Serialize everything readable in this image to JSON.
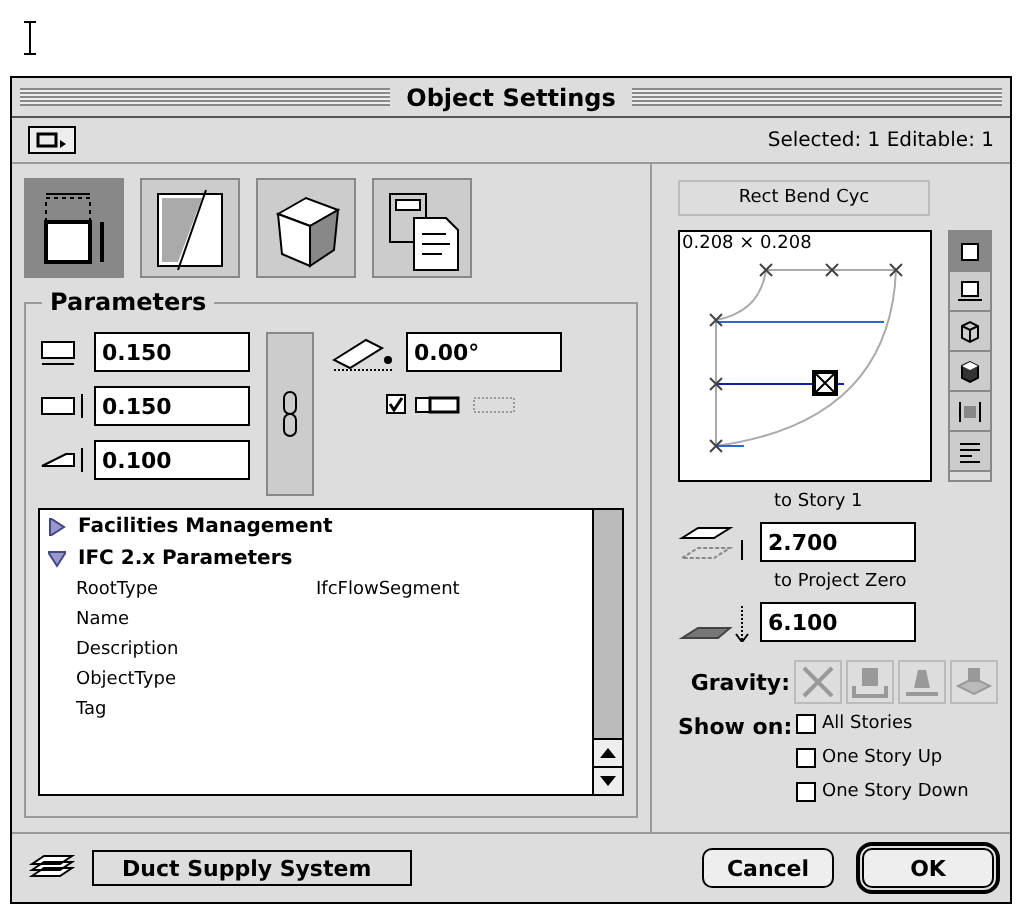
{
  "window": {
    "title": "Object Settings"
  },
  "toolbar": {
    "status": "Selected: 1 Editable: 1"
  },
  "tool_tabs": [
    {
      "kind": "size",
      "selected": true
    },
    {
      "kind": "section",
      "selected": false
    },
    {
      "kind": "model",
      "selected": false
    },
    {
      "kind": "listing",
      "selected": false
    }
  ],
  "parameters": {
    "title": "Parameters",
    "fields": [
      {
        "kind": "width",
        "value": "0.150"
      },
      {
        "kind": "height",
        "value": "0.150"
      },
      {
        "kind": "length",
        "value": "0.100"
      }
    ],
    "angle": {
      "value": "0.00°"
    },
    "mirror": {
      "checked": true
    },
    "tree": [
      {
        "label": "Facilities Management",
        "expanded": false
      },
      {
        "label": "IFC 2.x Parameters",
        "expanded": true,
        "children": [
          {
            "name": "RootType",
            "value": "IfcFlowSegment"
          },
          {
            "name": "Name"
          },
          {
            "name": "Description"
          },
          {
            "name": "ObjectType"
          },
          {
            "name": "Tag"
          }
        ]
      }
    ]
  },
  "preview": {
    "title": "Rect Bend Cyc",
    "dimension": "0.208 × 0.208",
    "view_buttons": [
      {
        "kind": "plan",
        "selected": true
      },
      {
        "kind": "floor",
        "selected": false
      },
      {
        "kind": "wire",
        "selected": false
      },
      {
        "kind": "solid",
        "selected": false
      },
      {
        "kind": "section",
        "selected": false
      },
      {
        "kind": "list",
        "selected": false
      }
    ]
  },
  "elevation": [
    {
      "label": "to Story 1",
      "value": "2.700",
      "kind": "story"
    },
    {
      "label": "to Project Zero",
      "value": "6.100",
      "kind": "zero"
    }
  ],
  "gravity": {
    "label": "Gravity:",
    "buttons": [
      {
        "kind": "none"
      },
      {
        "kind": "top"
      },
      {
        "kind": "bottom"
      },
      {
        "kind": "slab"
      }
    ]
  },
  "show_on": {
    "label": "Show on:",
    "options": [
      {
        "label": "All Stories",
        "checked": false
      },
      {
        "label": "One Story Up",
        "checked": false
      },
      {
        "label": "One Story Down",
        "checked": false
      }
    ]
  },
  "footer": {
    "layer": "Duct Supply System",
    "buttons": [
      {
        "label": "Cancel",
        "default": false
      },
      {
        "label": "OK",
        "default": true
      }
    ]
  }
}
